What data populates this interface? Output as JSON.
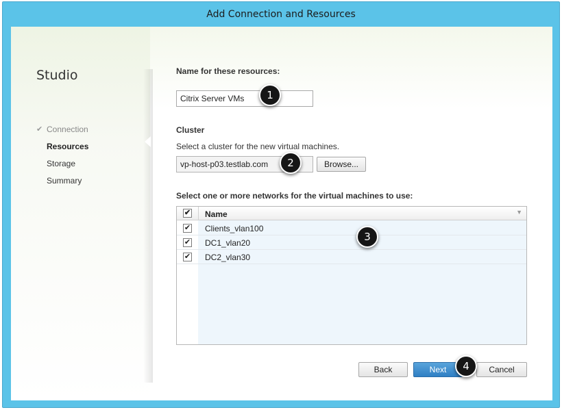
{
  "window": {
    "title": "Add Connection and Resources"
  },
  "sidebar": {
    "app_title": "Studio",
    "steps": [
      {
        "label": "Connection",
        "state": "done"
      },
      {
        "label": "Resources",
        "state": "current"
      },
      {
        "label": "Storage",
        "state": "pending"
      },
      {
        "label": "Summary",
        "state": "pending"
      }
    ]
  },
  "form": {
    "name_label": "Name for these resources:",
    "name_value": "Citrix Server VMs",
    "cluster_heading": "Cluster",
    "cluster_desc": "Select a cluster for the new virtual machines.",
    "cluster_value": "vp-host-p03.testlab.com",
    "browse_label": "Browse...",
    "networks_label": "Select one or more networks for the virtual machines to use:",
    "networks": {
      "header": "Name",
      "select_all_checked": true,
      "rows": [
        {
          "name": "Clients_vlan100",
          "checked": true
        },
        {
          "name": "DC1_vlan20",
          "checked": true
        },
        {
          "name": "DC2_vlan30",
          "checked": true
        }
      ]
    }
  },
  "footer": {
    "back_label": "Back",
    "next_label": "Next",
    "cancel_label": "Cancel"
  },
  "callouts": [
    "1",
    "2",
    "3",
    "4"
  ],
  "colors": {
    "frame": "#5bc3e8",
    "primary_button": "#2f7fc4",
    "list_tint": "#eef6fc"
  }
}
